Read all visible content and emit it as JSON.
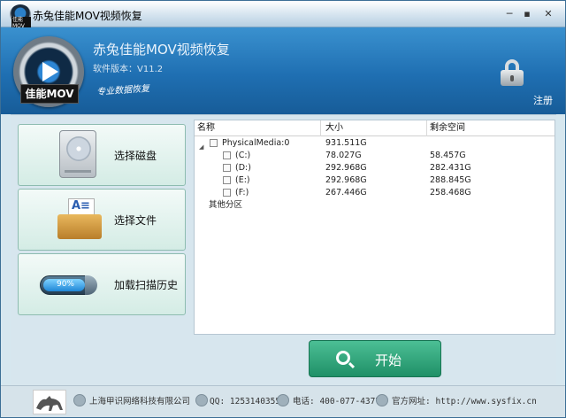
{
  "window": {
    "title": "赤兔佳能MOV视频恢复",
    "logo_caption": "佳能MOV"
  },
  "header": {
    "app_name": "赤兔佳能MOV视频恢复",
    "version": "软件版本：V11.2",
    "slogan": "专业数据恢复",
    "logo_label": "佳能MOV",
    "register_label": "注册"
  },
  "menu": [
    {
      "label": "选择磁盘",
      "icon": "hard-disk-icon"
    },
    {
      "label": "选择文件",
      "icon": "folder-icon"
    },
    {
      "label": "加载扫描历史",
      "icon": "progress-icon",
      "progress_label": "90%",
      "progress": 0.9
    }
  ],
  "table": {
    "columns": [
      "名称",
      "大小",
      "剩余空间"
    ],
    "root": {
      "name": "PhysicalMedia:0",
      "size": "931.511G",
      "free": ""
    },
    "partitions": [
      {
        "name": "(C:)",
        "size": "78.027G",
        "free": "58.457G"
      },
      {
        "name": "(D:)",
        "size": "292.968G",
        "free": "282.431G"
      },
      {
        "name": "(E:)",
        "size": "292.968G",
        "free": "288.845G"
      },
      {
        "name": "(F:)",
        "size": "267.446G",
        "free": "258.468G"
      }
    ],
    "other": "其他分区"
  },
  "start_label": "开始",
  "footer": {
    "company": "上海甲识网络科技有限公司",
    "qq": "QQ: 1253140355",
    "phone": "电话: 400-077-4377",
    "website": "官方网址: http://www.sysfix.cn"
  },
  "colors": {
    "header": "#1f6fb2",
    "start": "#2aa078",
    "progress": "#1f86d6"
  }
}
